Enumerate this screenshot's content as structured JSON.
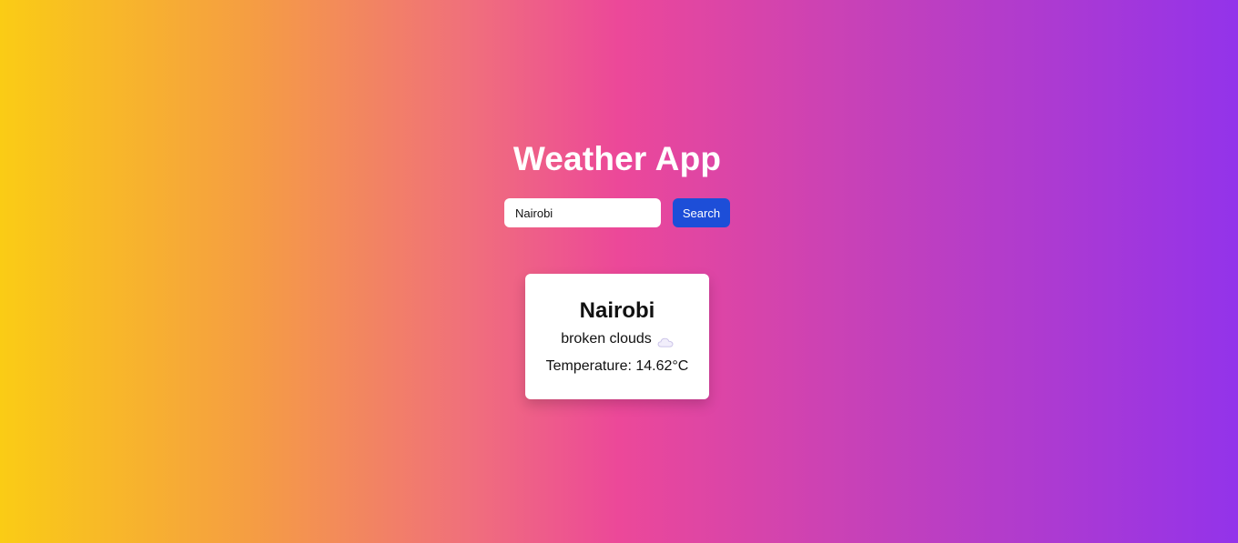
{
  "app": {
    "title": "Weather App"
  },
  "search": {
    "value": "Nairobi",
    "button_label": "Search"
  },
  "weather": {
    "city": "Nairobi",
    "description": "broken clouds",
    "icon": "cloud-icon",
    "temperature_label": "Temperature: 14.62°C"
  }
}
